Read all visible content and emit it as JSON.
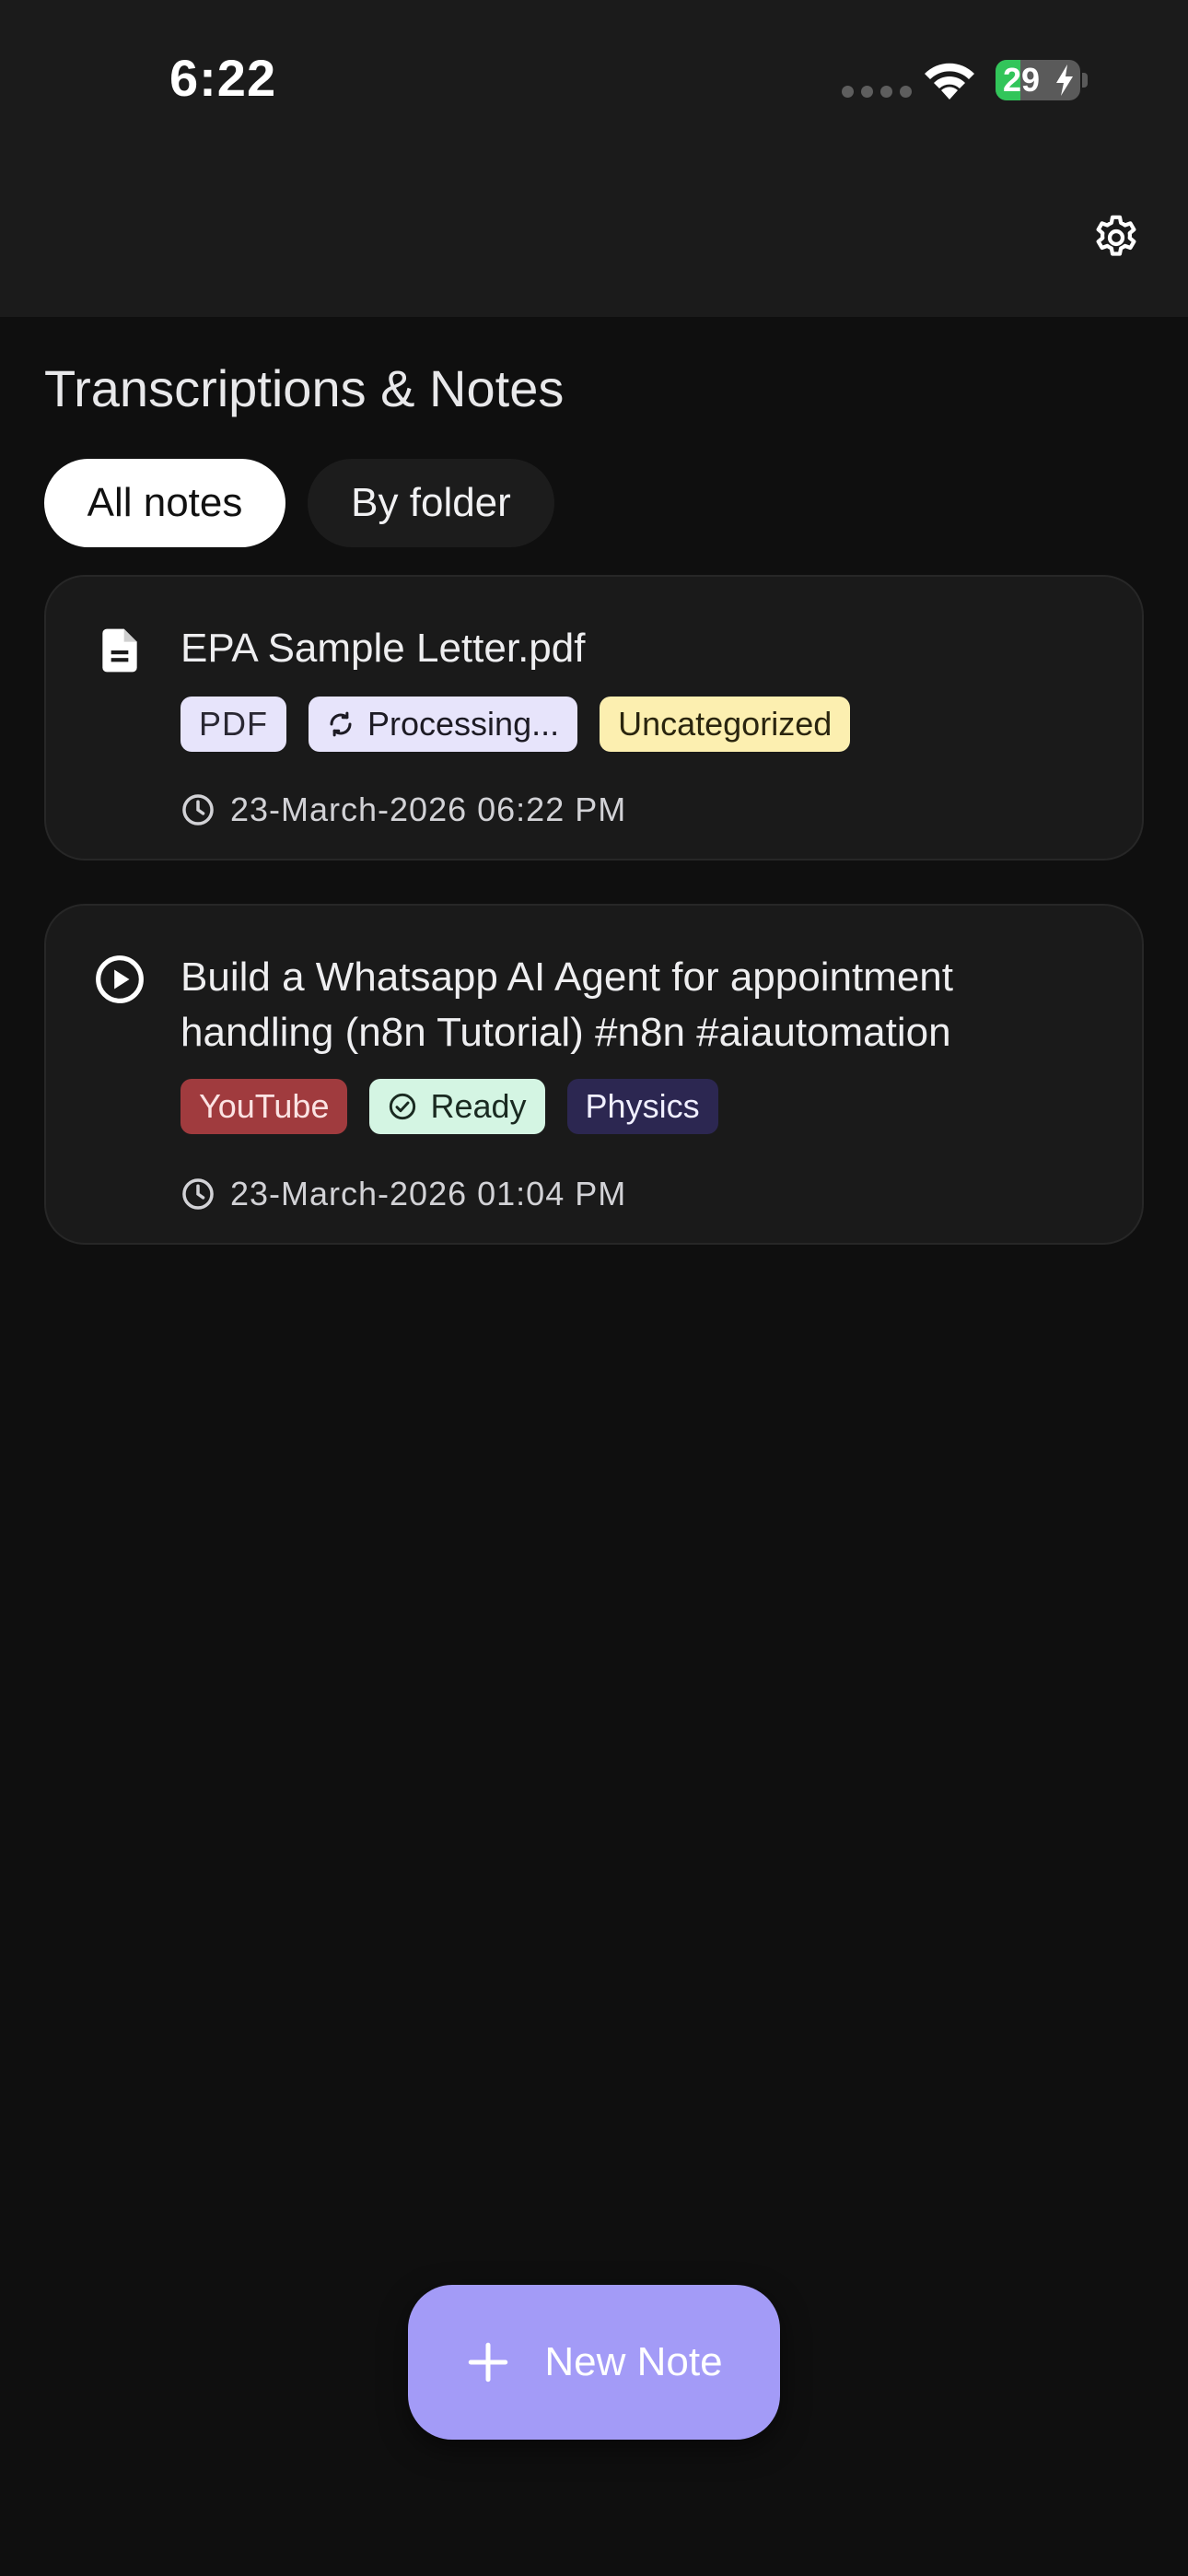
{
  "status_bar": {
    "time": "6:22",
    "battery_percent": "29",
    "battery_level": 0.29
  },
  "colors": {
    "accent": "#a39bf7",
    "background": "#0f0f0f",
    "surface": "#1a1a1a",
    "header": "#1b1b1b"
  },
  "header": {
    "settings_icon": "gear-icon"
  },
  "main": {
    "title": "Transcriptions & Notes",
    "tabs": [
      {
        "label": "All notes",
        "active": true
      },
      {
        "label": "By folder",
        "active": false
      }
    ],
    "notes": [
      {
        "icon": "document-icon",
        "title": "EPA Sample Letter.pdf",
        "badges": [
          {
            "label": "PDF",
            "kind": "source"
          },
          {
            "label": "Processing...",
            "kind": "status",
            "icon": "sync-icon"
          },
          {
            "label": "Uncategorized",
            "kind": "folder"
          }
        ],
        "timestamp": "23-March-2026 06:22 PM"
      },
      {
        "icon": "play-circle-icon",
        "title": "Build a Whatsapp AI Agent for appointment handling (n8n Tutorial) #n8n #aiautomation",
        "badges": [
          {
            "label": "YouTube",
            "kind": "source"
          },
          {
            "label": "Ready",
            "kind": "status",
            "icon": "check-circle-icon"
          },
          {
            "label": "Physics",
            "kind": "folder"
          }
        ],
        "timestamp": "23-March-2026 01:04 PM"
      }
    ]
  },
  "fab": {
    "label": "New Note",
    "icon": "plus-icon"
  }
}
